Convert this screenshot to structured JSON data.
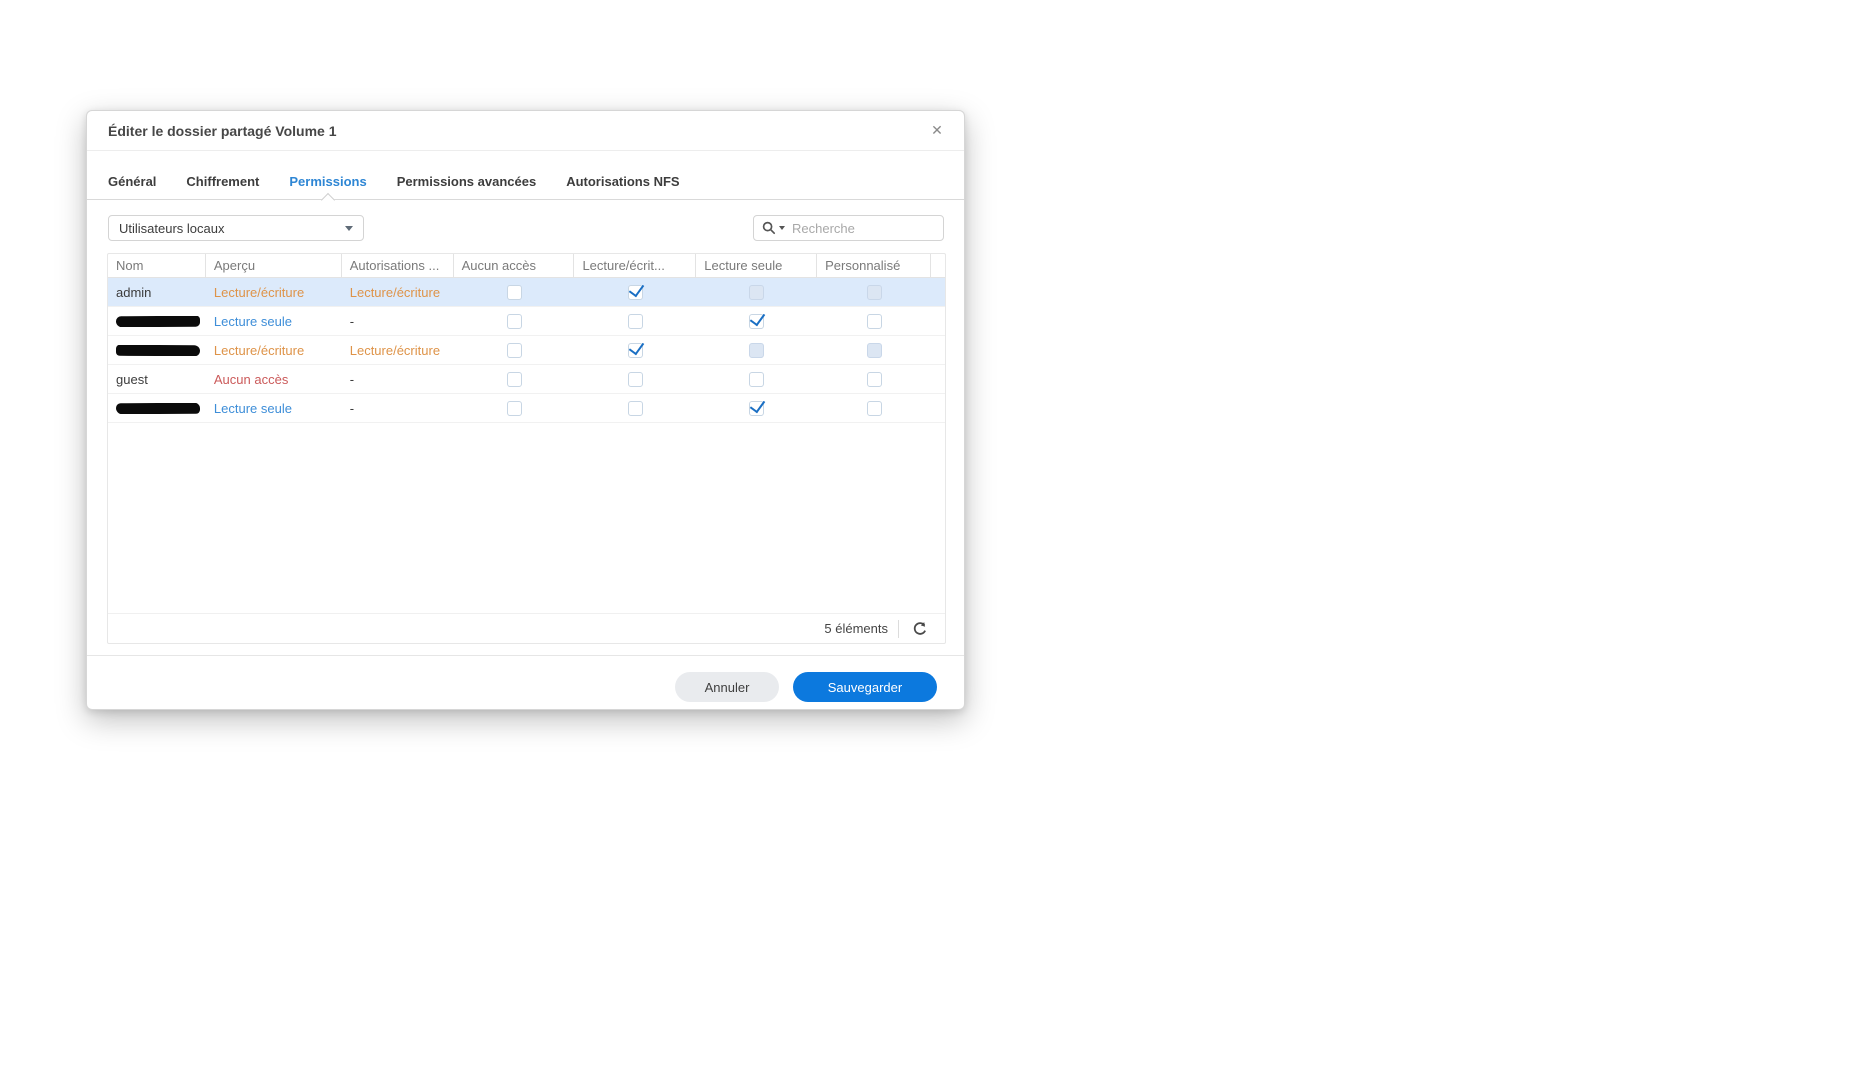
{
  "dialog": {
    "title": "Éditer le dossier partagé Volume 1",
    "close_glyph": "✕"
  },
  "tabs": [
    {
      "label": "Général",
      "active": false
    },
    {
      "label": "Chiffrement",
      "active": false
    },
    {
      "label": "Permissions",
      "active": true
    },
    {
      "label": "Permissions avancées",
      "active": false
    },
    {
      "label": "Autorisations NFS",
      "active": false
    }
  ],
  "toolbar": {
    "user_type_dropdown": {
      "value": "Utilisateurs locaux"
    },
    "search": {
      "placeholder": "Recherche"
    }
  },
  "table": {
    "columns": [
      "Nom",
      "Aperçu",
      "Autorisations ...",
      "Aucun accès",
      "Lecture/écrit...",
      "Lecture seule",
      "Personnalisé"
    ],
    "rows": [
      {
        "name": "admin",
        "redacted": false,
        "selected": true,
        "apercu": {
          "text": "Lecture/écriture",
          "type": "rw"
        },
        "autorisations": {
          "text": "Lecture/écriture",
          "type": "rw"
        },
        "checkboxes": [
          "unchecked",
          "checked",
          "disabled",
          "disabled"
        ]
      },
      {
        "name": "",
        "redacted": true,
        "selected": false,
        "apercu": {
          "text": "Lecture seule",
          "type": "ro"
        },
        "autorisations": {
          "text": "-",
          "type": "dash"
        },
        "checkboxes": [
          "unchecked",
          "unchecked",
          "checked",
          "unchecked"
        ]
      },
      {
        "name": "",
        "redacted": true,
        "selected": false,
        "apercu": {
          "text": "Lecture/écriture",
          "type": "rw"
        },
        "autorisations": {
          "text": "Lecture/écriture",
          "type": "rw"
        },
        "checkboxes": [
          "unchecked",
          "checked",
          "disabled",
          "disabled"
        ]
      },
      {
        "name": "guest",
        "redacted": false,
        "selected": false,
        "apercu": {
          "text": "Aucun accès",
          "type": "none"
        },
        "autorisations": {
          "text": "-",
          "type": "dash"
        },
        "checkboxes": [
          "unchecked",
          "unchecked",
          "unchecked",
          "unchecked"
        ]
      },
      {
        "name": "",
        "redacted": true,
        "selected": false,
        "apercu": {
          "text": "Lecture seule",
          "type": "ro"
        },
        "autorisations": {
          "text": "-",
          "type": "dash"
        },
        "checkboxes": [
          "unchecked",
          "unchecked",
          "checked",
          "unchecked"
        ]
      }
    ]
  },
  "footer": {
    "count_label": "5 éléments"
  },
  "actions": {
    "cancel": "Annuler",
    "save": "Sauvegarder"
  },
  "colors": {
    "permission_rw": "#de9348",
    "permission_ro": "#3e8ed8",
    "permission_none": "#cb5a5a",
    "tab_active": "#2e86d4",
    "selected_row_bg": "#dceafb",
    "checkbox_check": "#1a6fc4",
    "save_button_bg": "#0c79de"
  }
}
